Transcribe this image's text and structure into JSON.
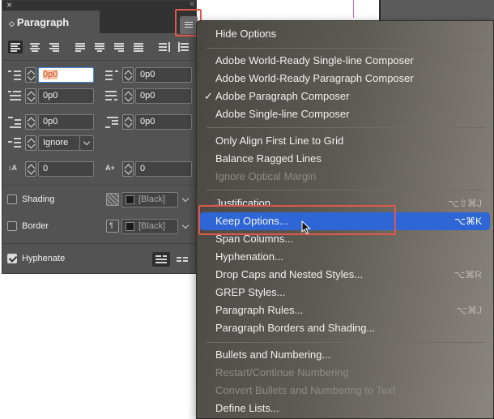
{
  "panel": {
    "tab_title": "Paragraph",
    "close_glyph": "×",
    "collapse_glyph": "«",
    "tab_chevron": "◇",
    "left_indent": "0p0",
    "right_indent": "0p0",
    "first_line_indent": "0p0",
    "last_line_indent": "0p0",
    "space_before": "0p0",
    "space_after": "0p0",
    "align_to_grid": "Ignore",
    "drop_cap_lines": "0",
    "drop_cap_chars": "0",
    "shading_label": "Shading",
    "shading_color": "[Black]",
    "border_label": "Border",
    "border_color": "[Black]",
    "hyphenate_label": "Hyphenate",
    "hyphenate_checked": true,
    "shading_checked": false,
    "border_checked": false
  },
  "menu": {
    "items": [
      {
        "label": "Hide Options",
        "shortcut": "",
        "disabled": false
      },
      {
        "label": "Adobe World-Ready Single-line Composer",
        "shortcut": "",
        "disabled": false
      },
      {
        "label": "Adobe World-Ready Paragraph Composer",
        "shortcut": "",
        "disabled": false
      },
      {
        "label": "Adobe Paragraph Composer",
        "shortcut": "",
        "disabled": false,
        "checked": true
      },
      {
        "label": "Adobe Single-line Composer",
        "shortcut": "",
        "disabled": false
      },
      {
        "label": "Only Align First Line to Grid",
        "shortcut": "",
        "disabled": false
      },
      {
        "label": "Balance Ragged Lines",
        "shortcut": "",
        "disabled": false
      },
      {
        "label": "Ignore Optical Margin",
        "shortcut": "",
        "disabled": true
      },
      {
        "label": "Justification...",
        "shortcut": "⌥⇧⌘J",
        "disabled": false
      },
      {
        "label": "Keep Options...",
        "shortcut": "⌥⌘K",
        "disabled": false,
        "highlighted": true
      },
      {
        "label": "Span Columns...",
        "shortcut": "",
        "disabled": false
      },
      {
        "label": "Hyphenation...",
        "shortcut": "",
        "disabled": false
      },
      {
        "label": "Drop Caps and Nested Styles...",
        "shortcut": "⌥⌘R",
        "disabled": false
      },
      {
        "label": "GREP Styles...",
        "shortcut": "",
        "disabled": false
      },
      {
        "label": "Paragraph Rules...",
        "shortcut": "⌥⌘J",
        "disabled": false
      },
      {
        "label": "Paragraph Borders and Shading...",
        "shortcut": "",
        "disabled": false
      },
      {
        "label": "Bullets and Numbering...",
        "shortcut": "",
        "disabled": false
      },
      {
        "label": "Restart/Continue Numbering",
        "shortcut": "",
        "disabled": true
      },
      {
        "label": "Convert Bullets and Numbering to Text",
        "shortcut": "",
        "disabled": true
      },
      {
        "label": "Define Lists...",
        "shortcut": "",
        "disabled": false
      }
    ],
    "checkmark": "✓"
  },
  "colors": {
    "highlight": "#2f66d6",
    "annotation_red": "#e0584c",
    "panel_bg": "#535353"
  }
}
